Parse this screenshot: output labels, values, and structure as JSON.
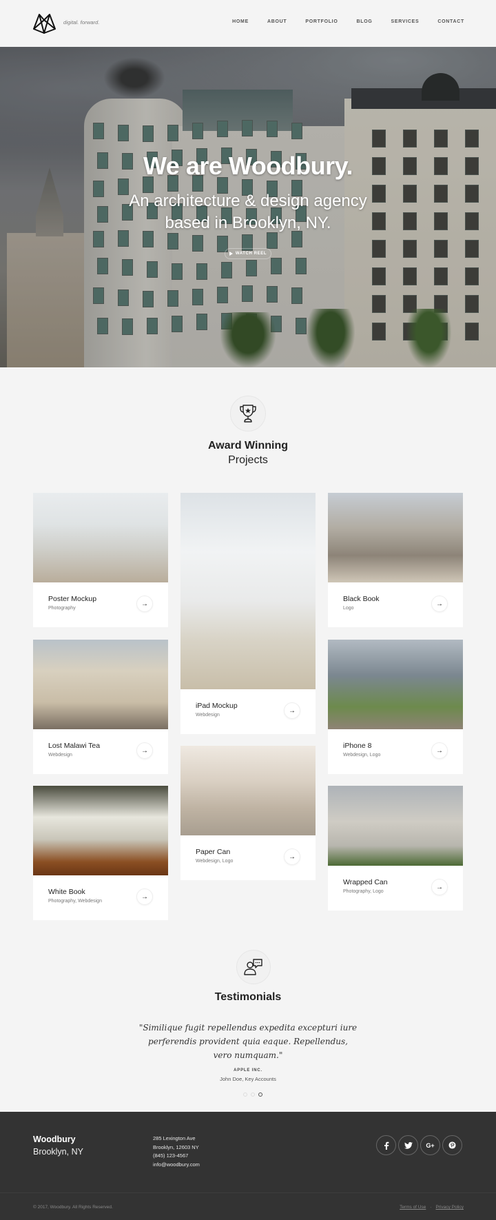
{
  "header": {
    "tagline": "digital. forward.",
    "nav": [
      "HOME",
      "ABOUT",
      "PORTFOLIO",
      "BLOG",
      "SERVICES",
      "CONTACT"
    ]
  },
  "hero": {
    "title": "We are Woodbury.",
    "subtitle_line1": "An architecture & design agency",
    "subtitle_line2": "based in Brooklyn, NY.",
    "watch_label": "WATCH REEL",
    "play_icon": "play-icon"
  },
  "projects": {
    "icon": "trophy-icon",
    "title_line1": "Award Winning",
    "title_line2": "Projects",
    "items": [
      {
        "name": "Poster Mockup",
        "category": "Photography"
      },
      {
        "name": "Lost Malawi Tea",
        "category": "Webdesign"
      },
      {
        "name": "White Book",
        "category": "Photography, Webdesign"
      },
      {
        "name": "iPad Mockup",
        "category": "Webdesign"
      },
      {
        "name": "Paper Can",
        "category": "Webdesign, Logo"
      },
      {
        "name": "Black Book",
        "category": "Logo"
      },
      {
        "name": "iPhone 8",
        "category": "Webdesign, Logo"
      },
      {
        "name": "Wrapped Can",
        "category": "Photography, Logo"
      }
    ],
    "arrow_glyph": "→"
  },
  "testimonials": {
    "icon": "user-speech-icon",
    "title": "Testimonials",
    "quote": "\"Similique fugit repellendus expedita excepturi iure perferendis provident quia eaque. Repellendus, vero numquam.\"",
    "company": "APPLE INC.",
    "person": "John Doe, Key Accounts",
    "slides": 3,
    "active_slide": 3
  },
  "footer": {
    "brand": "Woodbury",
    "city": "Brooklyn, NY",
    "address": [
      "285 Lexington Ave",
      "Brooklyn, 12603 NY",
      "(845) 123-4567",
      "info@woodbury.com"
    ],
    "socials": [
      {
        "name": "facebook",
        "glyph": "f"
      },
      {
        "name": "twitter",
        "glyph": "t"
      },
      {
        "name": "google-plus",
        "glyph": "G+"
      },
      {
        "name": "pinterest",
        "glyph": "P"
      }
    ],
    "copyright": "© 2017, Woodbury. All Rights Reserved.",
    "links": [
      "Terms of Use",
      "Privacy Policy"
    ],
    "link_separator": "·"
  },
  "colors": {
    "page_bg": "#f4f4f4",
    "footer_bg": "#333333",
    "text_dark": "#222222",
    "text_muted": "#777777"
  }
}
